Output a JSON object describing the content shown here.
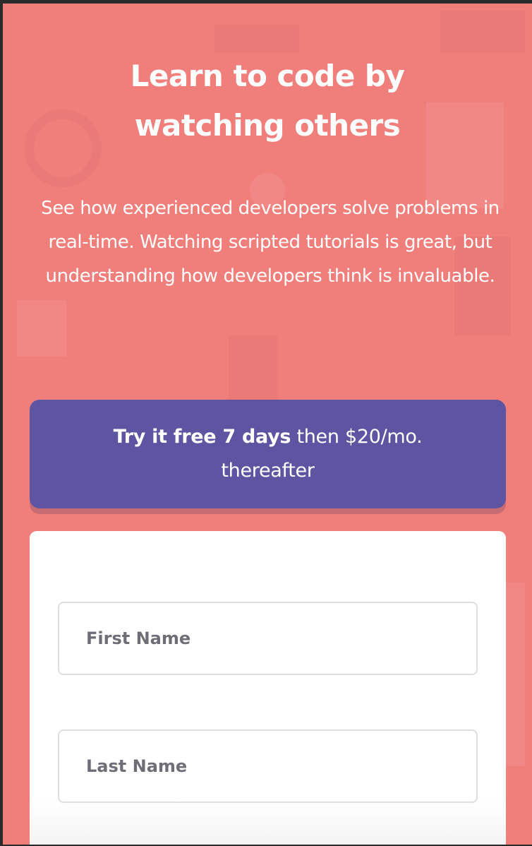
{
  "hero": {
    "title": "Learn to code by watching others",
    "description": "See how experienced developers solve problems in real-time. Watching scripted tutorials is great, but understanding how developers think is invaluable."
  },
  "promo": {
    "highlight": "Try it free 7 days",
    "rest": " then $20/mo. thereafter"
  },
  "form": {
    "first_name_placeholder": "First Name",
    "last_name_placeholder": "Last Name"
  },
  "colors": {
    "background": "#f07f7c",
    "promo_bg": "#5e55a2",
    "card_bg": "#ffffff"
  }
}
